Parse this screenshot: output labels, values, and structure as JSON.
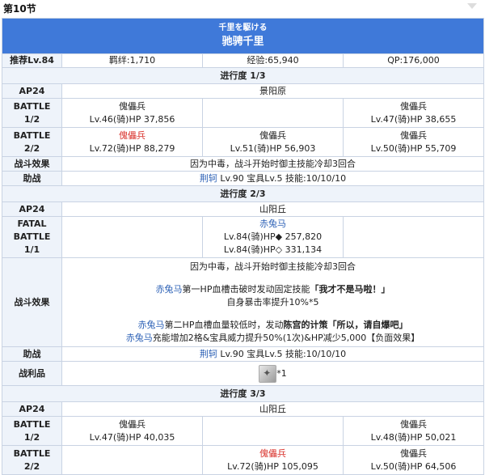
{
  "section_title": "第10节",
  "header": {
    "jp_title": "千里を駆ける",
    "cn_title": "驰骋千里"
  },
  "meta": {
    "level": "推荐Lv.84",
    "bond": "羁绊:1,710",
    "exp": "经验:65,940",
    "qp": "QP:176,000"
  },
  "p1": {
    "title": "进行度 1/3",
    "ap": "AP24",
    "location": "景阳原",
    "b1_label": "BATTLE",
    "b1_num": "1/2",
    "b1_l_name": "傀儡兵",
    "b1_l_stat": "Lv.46(骑)HP 37,856",
    "b1_r_name": "傀儡兵",
    "b1_r_stat": "Lv.47(骑)HP 38,655",
    "b2_label": "BATTLE",
    "b2_num": "2/2",
    "b2_l_name": "傀儡兵",
    "b2_l_stat": "Lv.72(骑)HP 88,279",
    "b2_m_name": "傀儡兵",
    "b2_m_stat": "Lv.51(骑)HP 56,903",
    "b2_r_name": "傀儡兵",
    "b2_r_stat": "Lv.50(骑)HP 55,709",
    "effect_label": "战斗效果",
    "effect_text": "因为中毒，战斗开始时御主技能冷却3回合",
    "support_label": "助战",
    "support_name": "荆轲",
    "support_text": " Lv.90 宝具Lv.5 技能:10/10/10"
  },
  "p2": {
    "title": "进行度 2/3",
    "ap": "AP24",
    "location": "山阳丘",
    "fb_label": "FATAL BATTLE",
    "fb_num": "1/1",
    "fb_name": "赤兔马",
    "fb_stat1": "Lv.84(骑)HP◆ 257,820",
    "fb_stat2": "Lv.84(骑)HP◇ 331,134",
    "effect_label": "战斗效果",
    "e1": "因为中毒，战斗开始时御主技能冷却3回合",
    "e2_name": "赤兔马",
    "e2_text": "第一HP血槽击破时发动固定技能",
    "e2_bold": "「我才不是马啦！」",
    "e3": "自身暴击率提升10%*5",
    "e4_name": "赤兔马",
    "e4_text": "第二HP血槽血量较低时，发动",
    "e4_bold": "陈宫的计策「所以，请自爆吧」",
    "e5_name": "赤兔马",
    "e5_text": "充能增加2格&宝具威力提升50%(1次)&HP减少5,000【负面效果】",
    "support_label": "助战",
    "support_name": "荆轲",
    "support_text": " Lv.90 宝具Lv.5 技能:10/10/10",
    "drop_label": "战利品",
    "drop_count": "*1"
  },
  "p3": {
    "title": "进行度 3/3",
    "ap": "AP24",
    "location": "山阳丘",
    "b1_label": "BATTLE",
    "b1_num": "1/2",
    "b1_l_name": "傀儡兵",
    "b1_l_stat": "Lv.47(骑)HP 40,035",
    "b1_r_name": "傀儡兵",
    "b1_r_stat": "Lv.48(骑)HP 50,021",
    "b2_label": "BATTLE",
    "b2_num": "2/2",
    "b2_m_name": "傀儡兵",
    "b2_m_stat": "Lv.72(骑)HP 105,095",
    "b2_r_name": "傀儡兵",
    "b2_r_stat": "Lv.50(骑)HP 64,506"
  },
  "colors": {
    "header_bg": "#3f79d9",
    "label_bg": "#eef3fa",
    "border": "#c9d3e3",
    "red": "#d9302a",
    "link_blue": "#2a5fb5"
  },
  "icons": {
    "drop_item": "item-icon"
  }
}
